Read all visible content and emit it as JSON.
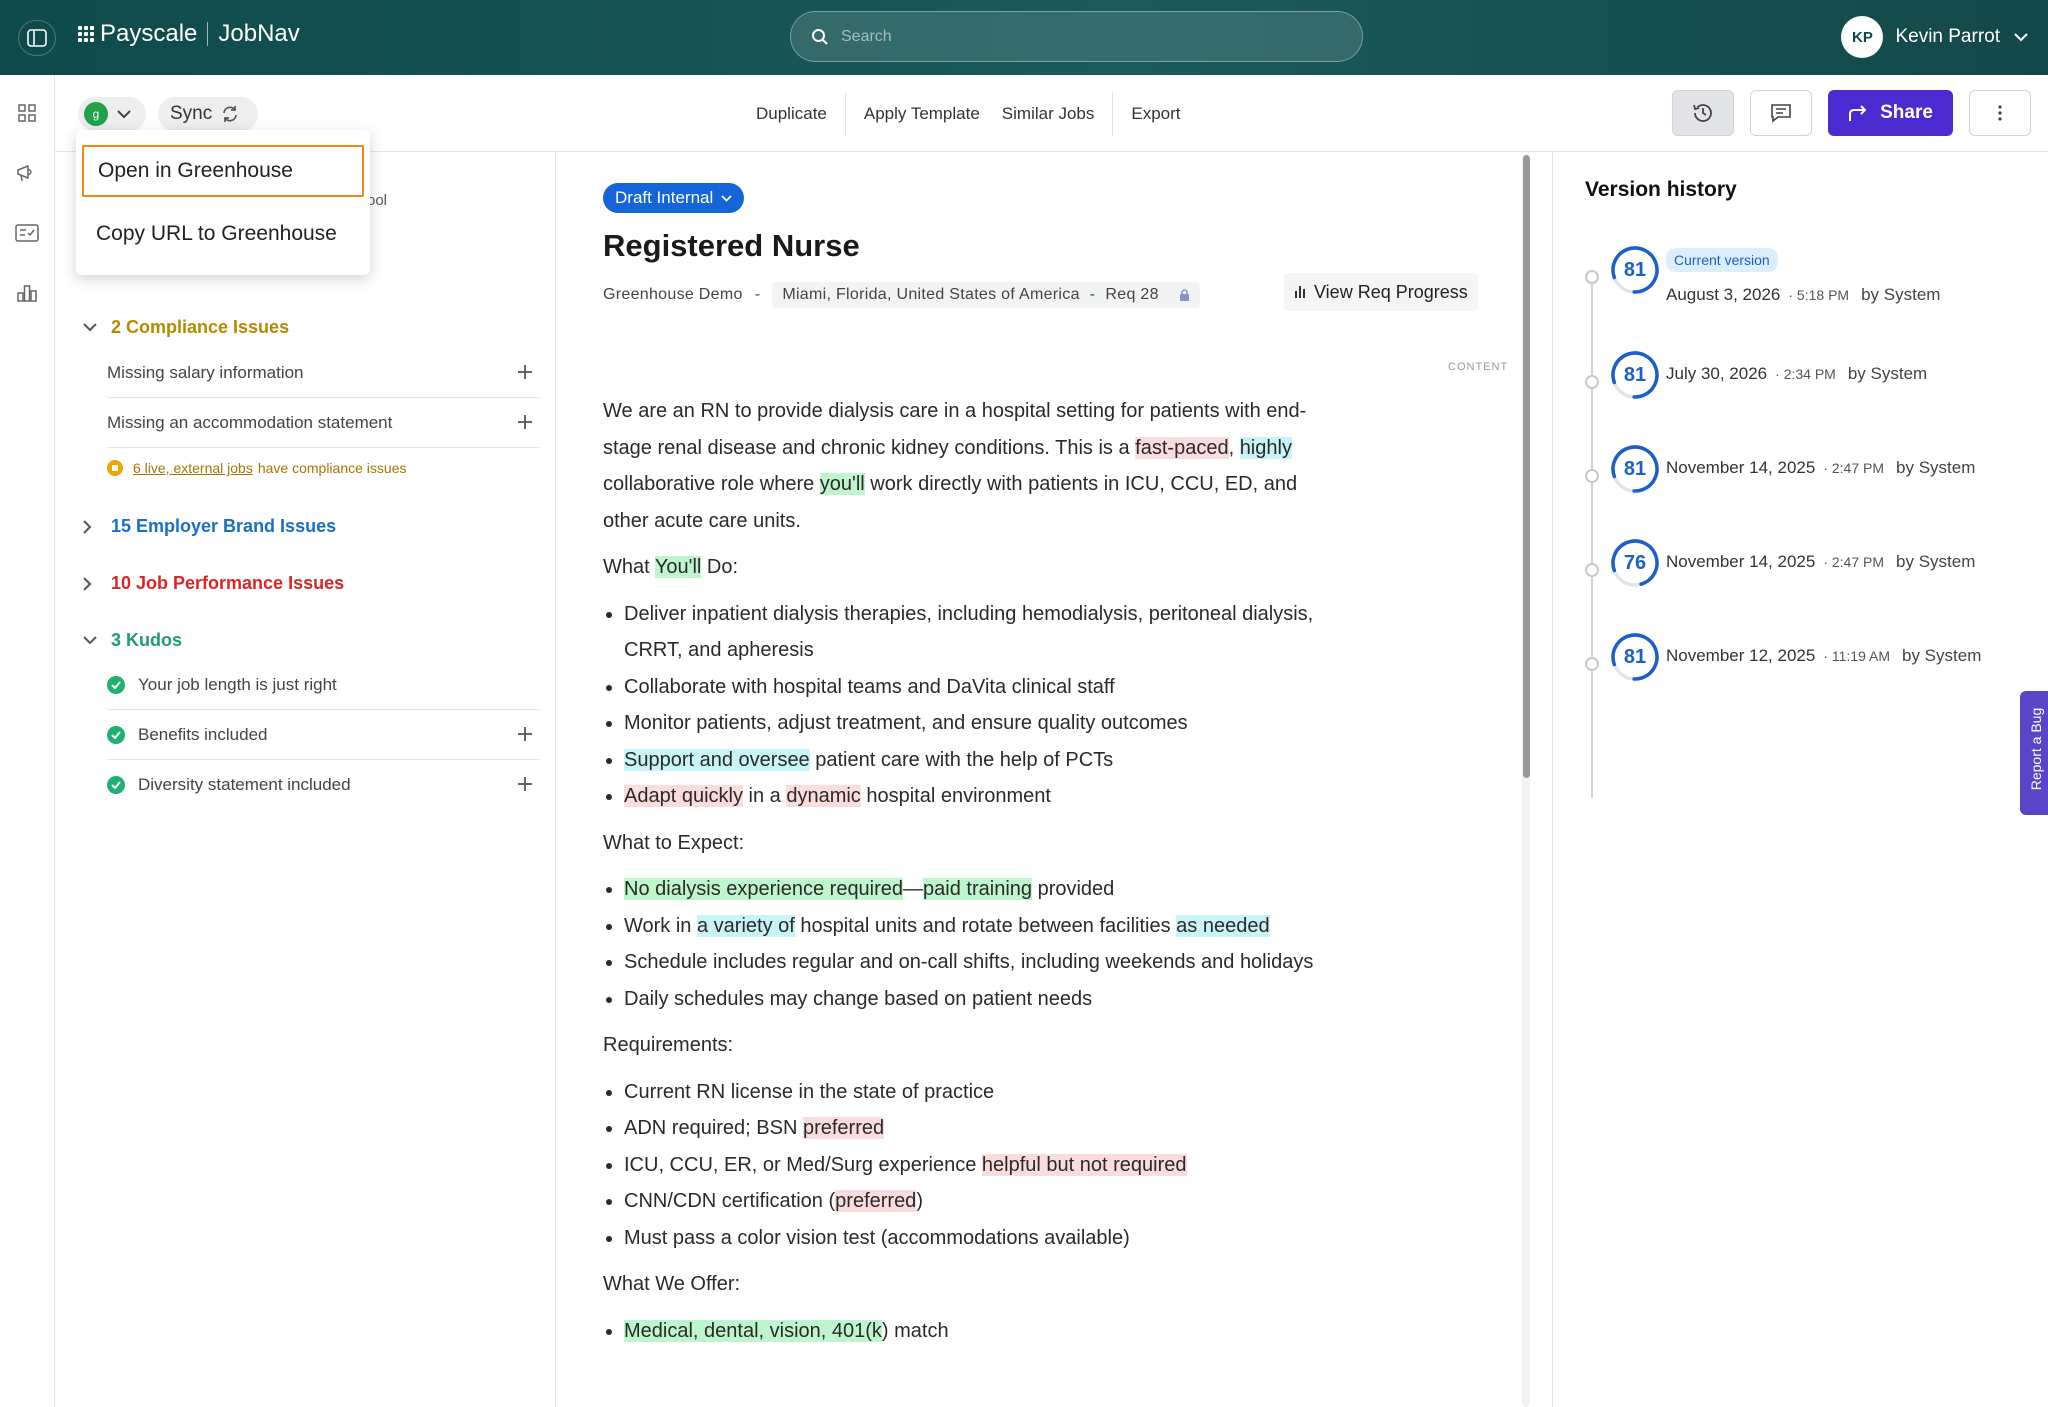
{
  "header": {
    "brand": "Payscale",
    "product": "JobNav",
    "search_placeholder": "Search",
    "user": {
      "initials": "KP",
      "name": "Kevin Parrot"
    }
  },
  "toolbar": {
    "integration_icon": "greenhouse-icon",
    "sync_label": "Sync",
    "actions": [
      "Duplicate",
      "Apply Template",
      "Similar Jobs",
      "Export"
    ],
    "share_label": "Share"
  },
  "dropdown": {
    "items": [
      "Open in Greenhouse",
      "Copy URL to Greenhouse"
    ]
  },
  "issues": {
    "hidden_fragment": "ool",
    "compliance": {
      "title": "2 Compliance Issues",
      "color": "#b58a00",
      "items": [
        "Missing salary information",
        "Missing an accommodation statement"
      ],
      "warning_link": "6 live, external jobs",
      "warning_text": "have compliance issues"
    },
    "employer_brand": {
      "title": "15 Employer Brand Issues",
      "color": "#1a6fc4"
    },
    "job_performance": {
      "title": "10 Job Performance Issues",
      "color": "#d92626"
    },
    "kudos": {
      "title": "3 Kudos",
      "color": "#1e9e6a",
      "items": [
        "Your job length is just right",
        "Benefits included",
        "Diversity statement included"
      ]
    }
  },
  "doc": {
    "status": "Draft Internal",
    "title": "Registered Nurse",
    "company": "Greenhouse Demo",
    "location": "Miami, Florida, United States of America",
    "req": "Req 28",
    "req_progress": "View Req Progress",
    "content_label": "CONTENT",
    "intro": {
      "a": "We are an RN to provide dialysis care in a hospital setting for patients with end-stage renal disease and chronic kidney conditions. This is a ",
      "h1": "fast-paced",
      "b": ", ",
      "h2": "highly",
      "c": " collaborative role where ",
      "h3": "you'll",
      "d": " work directly with patients in ICU, CCU, ED, and other acute care units."
    },
    "wyd": {
      "a": "What ",
      "h": "You'll",
      "b": " Do:"
    },
    "wyd_items": {
      "i1": "Deliver inpatient dialysis therapies, including hemodialysis, peritoneal dialysis, CRRT, and apheresis",
      "i2": "Collaborate with hospital teams and DaVita clinical staff",
      "i3": "Monitor patients, adjust treatment, and ensure quality outcomes",
      "i4h": "Support and oversee",
      "i4": " patient care with the help of PCTs",
      "i5h": "Adapt quickly",
      "i5a": " in a ",
      "i5h2": "dynamic",
      "i5b": " hospital environment"
    },
    "wte": "What to Expect:",
    "wte_items": {
      "i1h": "No dialysis experience required",
      "i1a": "—",
      "i1h2": "paid training",
      "i1b": " provided",
      "i2a": "Work in ",
      "i2h": "a variety of",
      "i2b": " hospital units and rotate between facilities ",
      "i2h2": "as needed",
      "i3": "Schedule includes regular and on-call shifts, including weekends and holidays",
      "i4": "Daily schedules may change based on patient needs"
    },
    "req_head": "Requirements:",
    "req_items": {
      "i1": "Current RN license in the state of practice",
      "i2a": "ADN required; BSN ",
      "i2h": "preferred",
      "i3a": "ICU, CCU, ER, or Med/Surg experience ",
      "i3h": "helpful but not required",
      "i4a": "CNN/CDN certification (",
      "i4h": "preferred",
      "i4b": ")",
      "i5": "Must pass a color vision test (accommodations available)"
    },
    "offer_head": "What We Offer:",
    "offer_items": {
      "i1h": "Medical, dental, vision, 401(k",
      "i1b": ") match"
    }
  },
  "version_history": {
    "title": "Version history",
    "current_label": "Current version",
    "entries": [
      {
        "score": "81",
        "date": "August 3, 2026",
        "time": "· 5:18 PM",
        "by": "by System",
        "score_fraction": 0.81
      },
      {
        "score": "81",
        "date": "July 30, 2026",
        "time": "· 2:34 PM",
        "by": "by System",
        "score_fraction": 0.81
      },
      {
        "score": "81",
        "date": "November 14, 2025",
        "time": "· 2:47 PM",
        "by": "by System",
        "score_fraction": 0.81
      },
      {
        "score": "76",
        "date": "November 14, 2025",
        "time": "· 2:47 PM",
        "by": "by System",
        "score_fraction": 0.76
      },
      {
        "score": "81",
        "date": "November 12, 2025",
        "time": "· 11:19 AM",
        "by": "by System",
        "score_fraction": 0.81
      }
    ]
  },
  "report_bug": "Report a Bug"
}
